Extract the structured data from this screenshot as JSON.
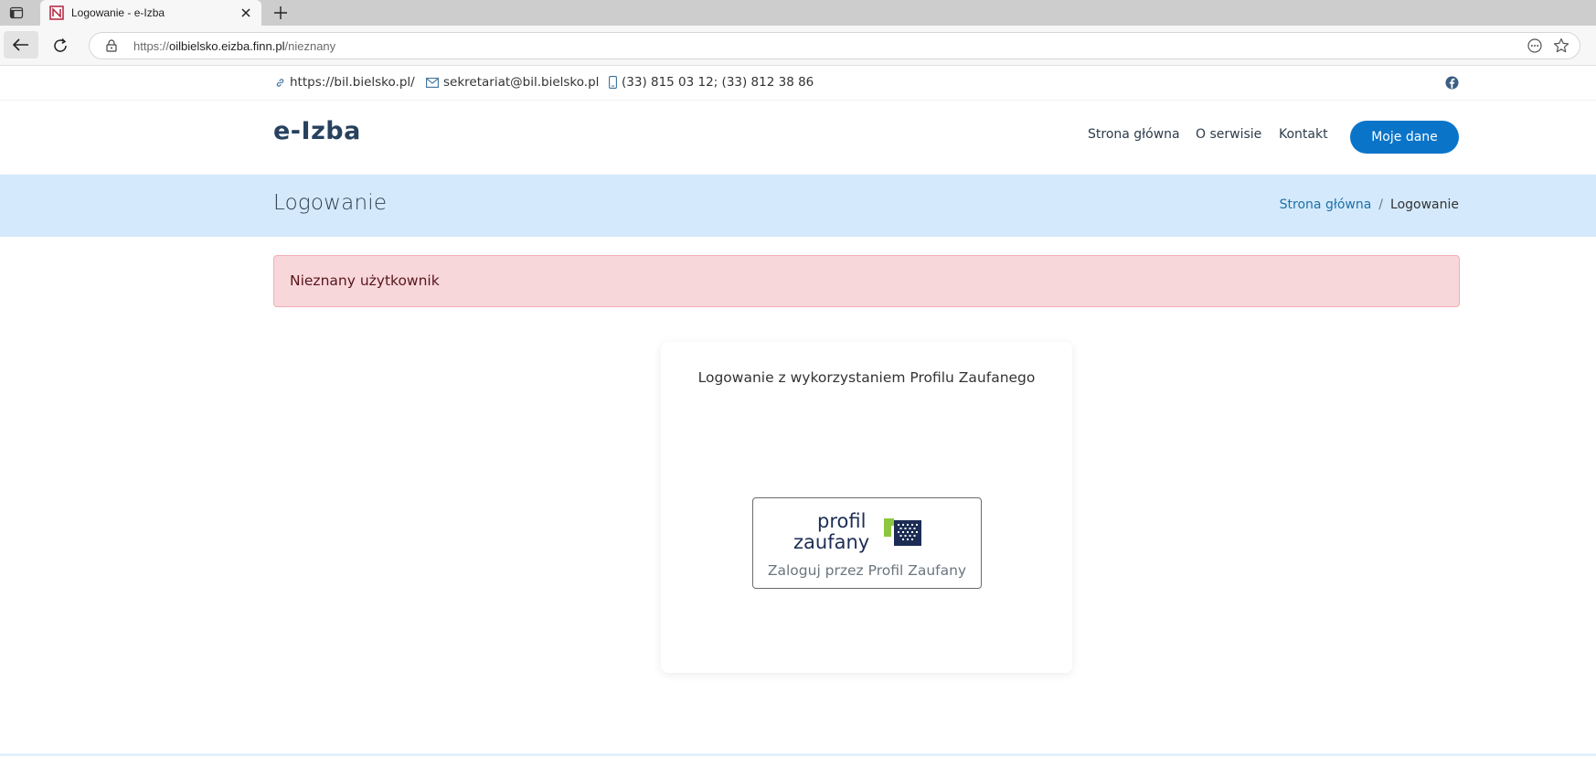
{
  "browser": {
    "tab_title": "Logowanie - e-Izba",
    "url_prefix": "https://",
    "url_host": "oilbielsko.eizba.finn.pl",
    "url_path": "/nieznany"
  },
  "contact": {
    "website": "https://bil.bielsko.pl/",
    "email": "sekretariat@bil.bielsko.pl",
    "phone": "(33) 815 03 12; (33) 812 38 86"
  },
  "header": {
    "logo": "e-Izba",
    "menu": [
      {
        "label": "Strona główna"
      },
      {
        "label": "O serwisie"
      },
      {
        "label": "Kontakt"
      }
    ],
    "cta_label": "Moje dane"
  },
  "titlebar": {
    "title": "Logowanie",
    "breadcrumb_home": "Strona główna",
    "breadcrumb_sep": "/",
    "breadcrumb_current": "Logowanie"
  },
  "alert": {
    "message": "Nieznany użytkownik"
  },
  "login_card": {
    "title": "Logowanie z wykorzystaniem Profilu Zaufanego",
    "button_label": "Zaloguj przez Profil Zaufany"
  },
  "colors": {
    "primary": "#0a74c9",
    "titlebar_bg": "#d4eafc",
    "alert_bg": "#f8d7da",
    "logo": "#27415e"
  },
  "icons": {
    "website": "link-icon",
    "email": "envelope-icon",
    "phone": "mobile-icon",
    "social": "facebook-icon",
    "login_logo": "profil-zaufany-logo"
  }
}
